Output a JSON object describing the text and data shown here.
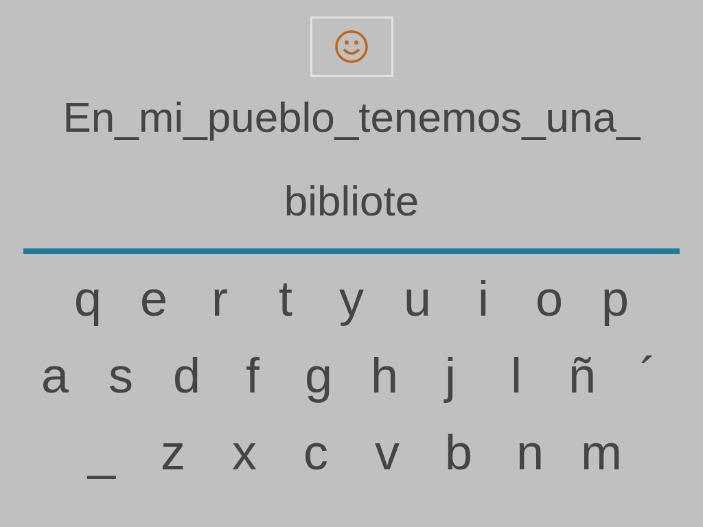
{
  "sentence_lines": [
    "En_mi_pueblo_tenemos_una_",
    "bibliote"
  ],
  "keyboard": {
    "rows": [
      [
        "q",
        "e",
        "r",
        "t",
        "y",
        "u",
        "i",
        "o",
        "p"
      ],
      [
        "a",
        "s",
        "d",
        "f",
        "g",
        "h",
        "j",
        "l",
        "ñ",
        "´"
      ],
      [
        "_",
        "z",
        "x",
        "c",
        "v",
        "b",
        "n",
        "m"
      ]
    ]
  }
}
